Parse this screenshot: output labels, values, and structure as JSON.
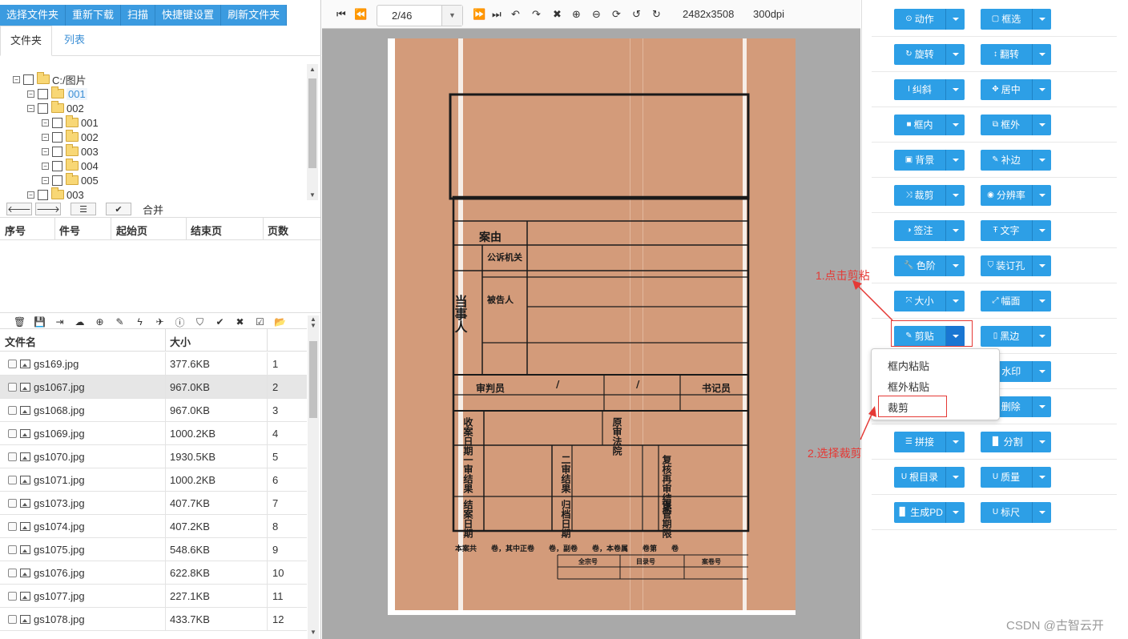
{
  "top_buttons": [
    "选择文件夹",
    "重新下载",
    "扫描",
    "快捷键设置",
    "刷新文件夹"
  ],
  "tabs": [
    "文件夹",
    "列表"
  ],
  "tree": {
    "root": "C:/图片",
    "items": [
      "001",
      "002",
      "001",
      "002",
      "003",
      "004",
      "005",
      "003"
    ]
  },
  "merge_label": "合并",
  "page_table_headers": [
    "序号",
    "件号",
    "起始页",
    "结束页",
    "页数"
  ],
  "file_table_headers": [
    "文件名",
    "大小"
  ],
  "files": [
    {
      "name": "gs169.jpg",
      "size": "377.6KB",
      "idx": "1"
    },
    {
      "name": "gs1067.jpg",
      "size": "967.0KB",
      "idx": "2"
    },
    {
      "name": "gs1068.jpg",
      "size": "967.0KB",
      "idx": "3"
    },
    {
      "name": "gs1069.jpg",
      "size": "1000.2KB",
      "idx": "4"
    },
    {
      "name": "gs1070.jpg",
      "size": "1930.5KB",
      "idx": "5"
    },
    {
      "name": "gs1071.jpg",
      "size": "1000.2KB",
      "idx": "6"
    },
    {
      "name": "gs1073.jpg",
      "size": "407.7KB",
      "idx": "7"
    },
    {
      "name": "gs1074.jpg",
      "size": "407.2KB",
      "idx": "8"
    },
    {
      "name": "gs1075.jpg",
      "size": "548.6KB",
      "idx": "9"
    },
    {
      "name": "gs1076.jpg",
      "size": "622.8KB",
      "idx": "10"
    },
    {
      "name": "gs1077.jpg",
      "size": "227.1KB",
      "idx": "11"
    },
    {
      "name": "gs1078.jpg",
      "size": "433.7KB",
      "idx": "12"
    }
  ],
  "viewer": {
    "page": "2/46",
    "dimensions": "2482x3508",
    "dpi": "300dpi"
  },
  "document": {
    "case_reason": "案由",
    "prosecutor": "公诉机关",
    "defendant": "被告人",
    "party": "当事人",
    "judge": "审判员",
    "clerk": "书记员",
    "slash1": "/",
    "slash2": "/",
    "receive_date": "收案日期",
    "original_court": "原审法院",
    "first_result": "一审结果",
    "second_result": "二审结果",
    "review_result": "复核再审结果",
    "close_date": "结案日期",
    "archive_date": "归档日期",
    "retention": "保管期限",
    "footer": "本案共　　卷，其中正卷　　卷，副卷　　卷，本卷属　　卷第　　卷",
    "fonds": "全宗号",
    "catalog": "目录号",
    "file_no": "案卷号"
  },
  "right_buttons": [
    [
      "动作",
      "框选"
    ],
    [
      "旋转",
      "翻转"
    ],
    [
      "纠斜",
      "居中"
    ],
    [
      "框内",
      "框外"
    ],
    [
      "背景",
      "补边"
    ],
    [
      "裁剪",
      "分辨率"
    ],
    [
      "签注",
      "文字"
    ],
    [
      "色阶",
      "装订孔"
    ],
    [
      "大小",
      "幅面"
    ],
    [
      "剪贴",
      "黑边"
    ],
    [
      "",
      "水印"
    ],
    [
      "",
      "删除"
    ],
    [
      "拼接",
      "分割"
    ],
    [
      "根目录",
      "质量"
    ],
    [
      "生成PD",
      "标尺"
    ]
  ],
  "dropdown": [
    "框内粘贴",
    "框外粘贴",
    "裁剪"
  ],
  "annotations": {
    "step1": "1.点击剪粘",
    "step2": "2.选择裁剪"
  },
  "watermark": "CSDN @古智云开"
}
